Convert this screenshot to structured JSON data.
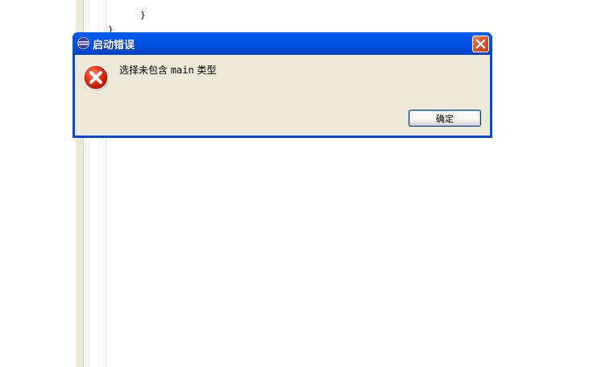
{
  "editor": {
    "code_lines": [
      "}",
      "}"
    ]
  },
  "dialog": {
    "title": "启动错误",
    "message_prefix": "选择未包含 ",
    "message_code": "main",
    "message_suffix": " 类型",
    "ok_label": "确定",
    "icons": {
      "app": "eclipse-icon",
      "close": "close-icon",
      "error": "error-icon"
    },
    "colors": {
      "titlebar": "#0054e3",
      "close_button": "#d8502c",
      "error": "#d81e05",
      "client": "#ece9d8"
    }
  }
}
